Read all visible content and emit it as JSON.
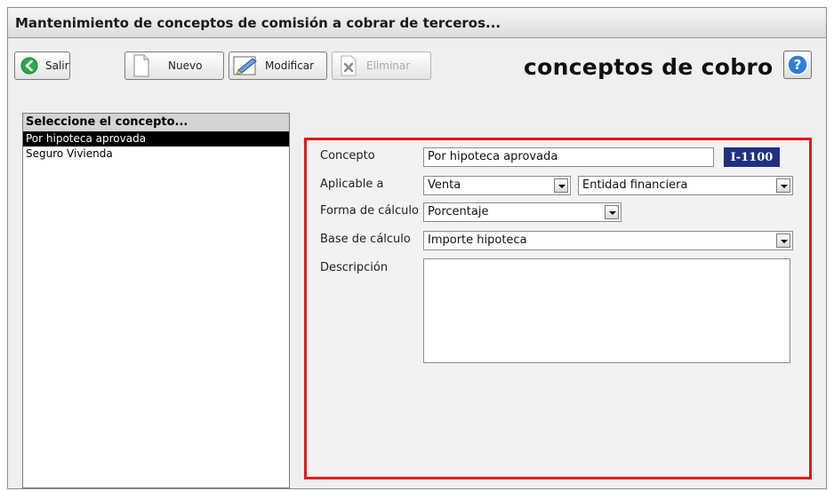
{
  "window": {
    "title": "Mantenimiento de conceptos de comisión a cobrar de terceros..."
  },
  "toolbar": {
    "exit_label": "Salir",
    "new_label": "Nuevo",
    "edit_label": "Modificar",
    "delete_label": "Eliminar",
    "module_title": "conceptos de cobro"
  },
  "list": {
    "header": "Seleccione el concepto...",
    "items": [
      {
        "label": "Por hipoteca aprovada",
        "selected": true
      },
      {
        "label": "Seguro Vivienda",
        "selected": false
      }
    ]
  },
  "form": {
    "concepto": {
      "label": "Concepto",
      "value": "Por hipoteca aprovada",
      "code": "I-1100"
    },
    "aplicable": {
      "label": "Aplicable a",
      "value1": "Venta",
      "value2": "Entidad financiera"
    },
    "forma": {
      "label": "Forma de cálculo",
      "value": "Porcentaje"
    },
    "base": {
      "label": "Base de cálculo",
      "value": "Importe hipoteca"
    },
    "descripcion": {
      "label": "Descripción",
      "value": ""
    }
  },
  "colors": {
    "highlight_border": "#e8131b",
    "code_badge": "#1f3080",
    "help_icon": "#2f7fd6",
    "exit_icon": "#2fa84a"
  },
  "icons": {
    "exit": "arrow-left-circle",
    "new": "blank-page",
    "edit": "pencil-page",
    "delete": "x-page",
    "help": "question-circle"
  }
}
